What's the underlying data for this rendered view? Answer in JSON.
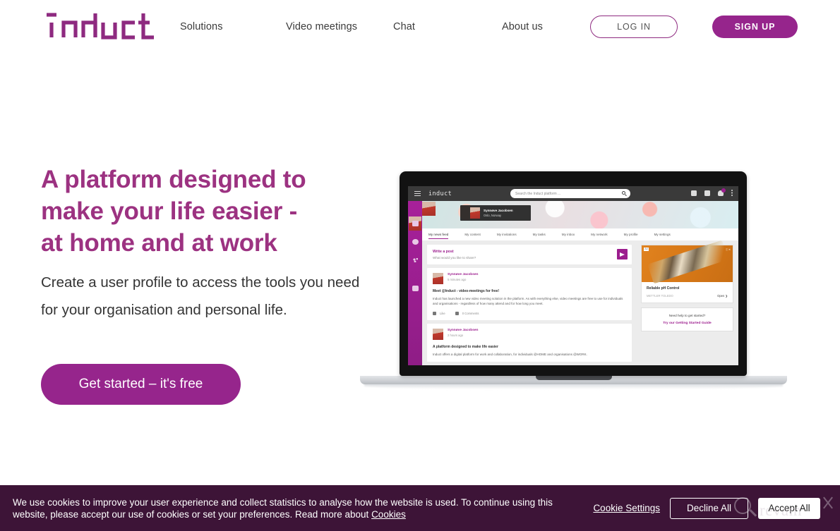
{
  "header": {
    "logo_text": "induct",
    "nav": [
      {
        "label": "Solutions"
      },
      {
        "label": "Video meetings"
      },
      {
        "label": "Chat"
      },
      {
        "label": "About us"
      }
    ],
    "login_label": "LOG IN",
    "signup_label": "SIGN UP",
    "accent_color": "#96258c"
  },
  "hero": {
    "title_line1": "A platform designed to",
    "title_line2": "make your life easier -",
    "title_line3": "at home and at work",
    "subtitle": "Create a user profile to access the tools you need for your organisation and personal life.",
    "cta_label": "Get started – it's free",
    "title_color": "#9c3281"
  },
  "mockup": {
    "app_logo": "induct",
    "search_placeholder": "Search the Induct platform ...",
    "notification_count": "0",
    "profile_card": {
      "name": "Synnøve Jacobsen",
      "location": "Oslo, Norway"
    },
    "tabs": [
      {
        "label": "My news feed",
        "active": true
      },
      {
        "label": "My content",
        "active": false
      },
      {
        "label": "My invitations",
        "active": false
      },
      {
        "label": "My tasks",
        "active": false
      },
      {
        "label": "My inbox",
        "active": false
      },
      {
        "label": "My network",
        "active": false
      },
      {
        "label": "My profile",
        "active": false
      },
      {
        "label": "My settings",
        "active": false
      }
    ],
    "composer": {
      "title": "Write a post",
      "placeholder": "What would you like to share?"
    },
    "posts": [
      {
        "author": "Synnøve Jacobsen",
        "time": "5 minutes ago",
        "title": "Meet @Induct - video-meetings for free!",
        "body": "Induct has launched a new video meeting solution in the platform. As with everything else, video meetings are free to use for individuals and organisations - regardless of how many attend and for how long you meet.",
        "like_label": "Like",
        "comments_label": "0 Comments"
      },
      {
        "author": "Synnøve Jacobsen",
        "time": "2 hours ago",
        "title": "A platform designed to make life easier",
        "body": "Induct offers a digital platform for work and collaboration, for individuals @HOME and organisations @WORK."
      }
    ],
    "ad": {
      "badge": "Ad",
      "badge_right": "ⓘ ✕",
      "title": "Reliable pH Control",
      "brand": "METTLER TOLEDO",
      "open_label": "Open ❯"
    },
    "help": {
      "question": "Need help to get started?",
      "link": "Try our Getting Started Guide"
    }
  },
  "cookie": {
    "text_line1": "We use cookies to improve your user experience and collect statistics to analyse how the website is used. To continue using this website,",
    "text_line2_prefix": "please accept our use of cookies or set your preferences. Read more about ",
    "cookies_link": "Cookies",
    "settings_label": "Cookie Settings",
    "decline_label": "Decline All",
    "accept_label": "Accept All",
    "background_color": "#3d1437",
    "watermark_text": "revam"
  }
}
